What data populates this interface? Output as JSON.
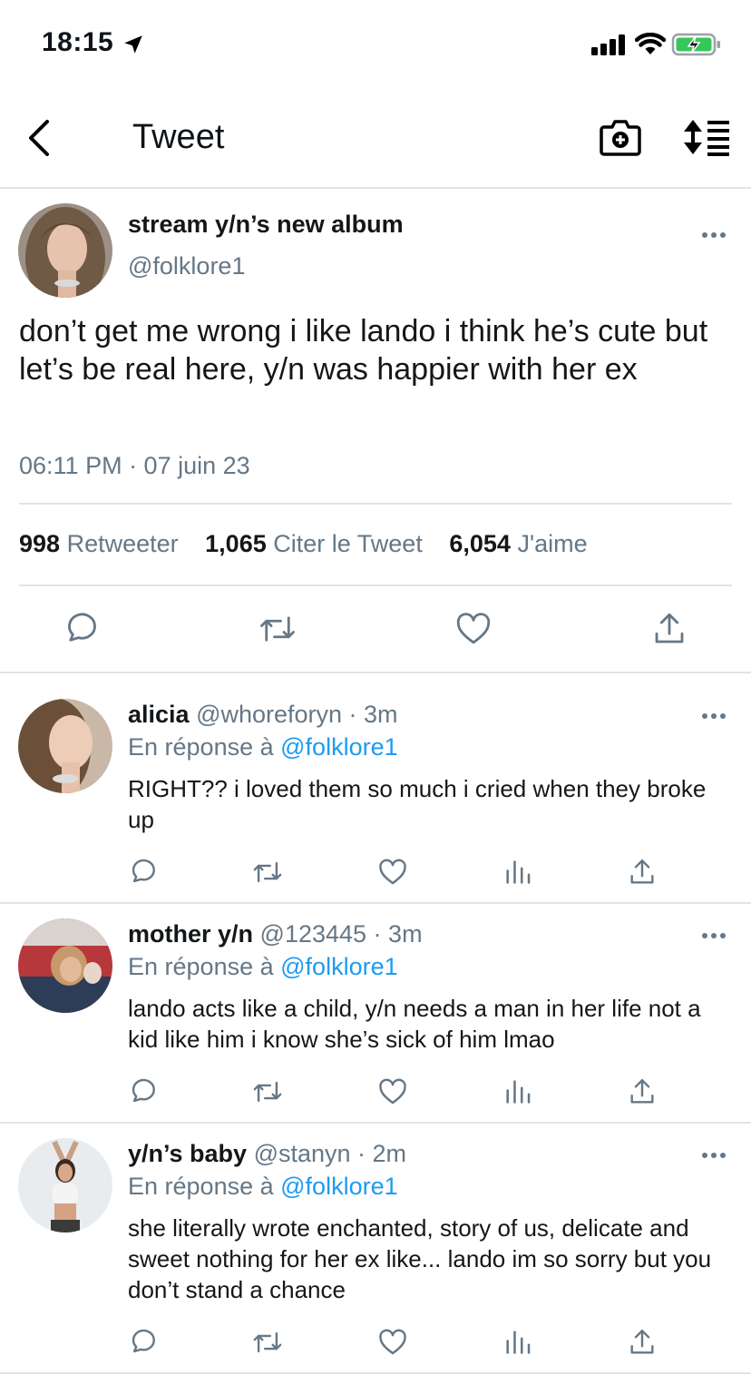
{
  "status_bar": {
    "time": "18:15",
    "icons": [
      "location-arrow-icon",
      "signal-bars-icon",
      "wifi-icon",
      "battery-charging-icon"
    ],
    "battery_color": "#34c759"
  },
  "nav": {
    "title": "Tweet",
    "icons": [
      "back-chevron-icon",
      "camera-icon",
      "sort-icon"
    ]
  },
  "main_tweet": {
    "display_name": "stream y/n’s new album",
    "handle": "@folklore1",
    "text": "don’t get me wrong i like lando i think he’s cute but let’s be real here, y/n was happier with her ex",
    "timestamp": "06:11 PM · 07 juin 23",
    "stats": {
      "retweets_count": "998",
      "retweets_label": "Retweeter",
      "quotes_count": "1,065",
      "quotes_label": "Citer le Tweet",
      "likes_count": "6,054",
      "likes_label": "J'aime"
    },
    "actions": [
      "reply-icon",
      "retweet-icon",
      "like-icon",
      "share-icon"
    ]
  },
  "replies": [
    {
      "display_name": "alicia",
      "meta": "@whoreforyn · 3m",
      "reply_prefix": "En réponse à",
      "reply_mention": "@folklore1",
      "text": "RIGHT?? i loved them so much i cried when they broke up"
    },
    {
      "display_name": "mother y/n",
      "meta": "@123445 · 3m",
      "reply_prefix": "En réponse à",
      "reply_mention": "@folklore1",
      "text": "lando acts like a child, y/n needs a man in her life not a kid like him i know she’s sick of him lmao"
    },
    {
      "display_name": "y/n’s baby",
      "meta": "@stanyn · 2m",
      "reply_prefix": "En réponse à",
      "reply_mention": "@folklore1",
      "text": "she literally wrote enchanted, story of us, delicate and sweet nothing for her ex like... lando im so sorry but you don’t stand a chance"
    }
  ],
  "colors": {
    "text": "#14171a",
    "secondary": "#657786",
    "link": "#1d9bf0",
    "divider": "#e1e4e6"
  }
}
